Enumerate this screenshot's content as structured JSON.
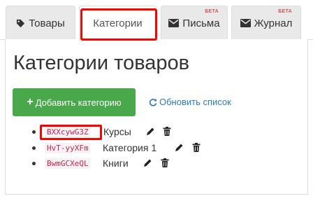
{
  "tabs": [
    {
      "label": "Товары",
      "icon": "tag-icon"
    },
    {
      "label": "Категории"
    },
    {
      "label": "Письма",
      "icon": "envelope-icon",
      "badge": "БЕТА"
    },
    {
      "label": "Журнал",
      "icon": "envelope-icon",
      "badge": "БЕТА"
    }
  ],
  "page": {
    "title": "Категории товаров",
    "add_button": "Добавить категорию",
    "refresh_link": "Обновить список"
  },
  "categories": [
    {
      "code": "BXXcywG3Z",
      "name": "Курсы"
    },
    {
      "code": "HvT-yyXFm",
      "name": "Категория 1"
    },
    {
      "code": "BwmGCXeQL",
      "name": "Книги"
    }
  ],
  "colors": {
    "accent_green": "#49a94a",
    "link_blue": "#2a7ab8",
    "code_red": "#c7254e",
    "highlight": "#ff0000"
  }
}
